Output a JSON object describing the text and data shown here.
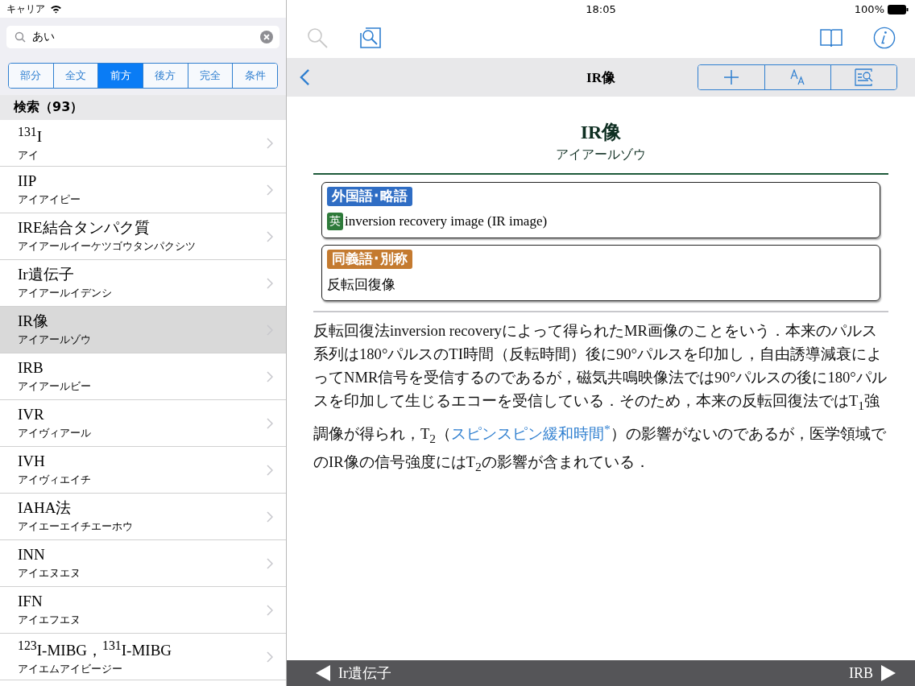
{
  "status_bar": {
    "carrier": "キャリア",
    "time": "18:05",
    "battery": "100%"
  },
  "search": {
    "value": "あい"
  },
  "modes": [
    {
      "label": "部分",
      "selected": false
    },
    {
      "label": "全文",
      "selected": false
    },
    {
      "label": "前方",
      "selected": true
    },
    {
      "label": "後方",
      "selected": false
    },
    {
      "label": "完全",
      "selected": false
    },
    {
      "label": "条件",
      "selected": false
    }
  ],
  "results_header": "検索（93）",
  "results": [
    {
      "title": "$^{131}$I",
      "reading": "アイ",
      "selected": false
    },
    {
      "title": "IIP",
      "reading": "アイアイピー",
      "selected": false
    },
    {
      "title": "IRE結合タンパク質",
      "reading": "アイアールイーケツゴウタンパクシツ",
      "selected": false
    },
    {
      "title": "Ir遺伝子",
      "reading": "アイアールイデンシ",
      "selected": false
    },
    {
      "title": "IR像",
      "reading": "アイアールゾウ",
      "selected": true
    },
    {
      "title": "IRB",
      "reading": "アイアールビー",
      "selected": false
    },
    {
      "title": "IVR",
      "reading": "アイヴィアール",
      "selected": false
    },
    {
      "title": "IVH",
      "reading": "アイヴィエイチ",
      "selected": false
    },
    {
      "title": "IAHA法",
      "reading": "アイエーエイチエーホウ",
      "selected": false
    },
    {
      "title": "INN",
      "reading": "アイエヌエヌ",
      "selected": false
    },
    {
      "title": "IFN",
      "reading": "アイエフエヌ",
      "selected": false
    },
    {
      "title": "$^{123}$I-MIBG，$^{131}$I-MIBG",
      "reading": "アイエムアイビージー",
      "selected": false
    }
  ],
  "nav": {
    "title": "IR像"
  },
  "entry": {
    "title": "IR像",
    "reading": "アイアールゾウ",
    "sections": [
      {
        "label": "外国語･略語",
        "color": "#2f6dc4",
        "lang": "英",
        "text": "inversion recovery image (IR image)"
      },
      {
        "label": "同義語･別称",
        "color": "#c47a2f",
        "text": "反転回復像"
      }
    ],
    "body": [
      {
        "kind": "text",
        "text": "反転回復法inversion recoveryによって得られたMR画像のことをいう．本来のパルス系列は180°パルスのTI時間（反転時間）後に90°パルスを印加し，自由誘導減衰によってNMR信号を受信するのであるが，磁気共鳴映像法では90°パルスの後に180°パルスを印加して生じるエコーを受信している．そのため，本来の反転回復法ではT$_{1}$強調像が得られ，T$_{2}$（"
      },
      {
        "kind": "link",
        "text": "スピンスピン緩和時間$^{*}$"
      },
      {
        "kind": "text",
        "text": "）の影響がないのであるが，医学領域でのIR像の信号強度にはT$_{2}$の影響が含まれている．"
      }
    ]
  },
  "footer": {
    "previous": "Ir遺伝子",
    "next": "IRB"
  }
}
